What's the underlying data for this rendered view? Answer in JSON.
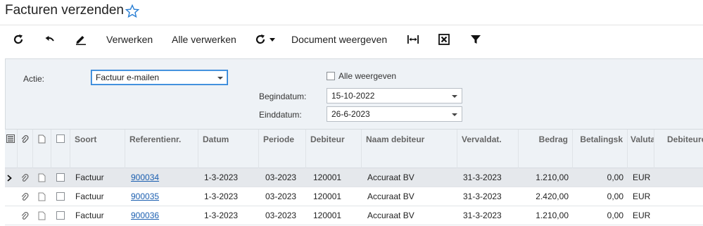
{
  "header": {
    "title": "Facturen verzenden"
  },
  "toolbar": {
    "process_label": "Verwerken",
    "process_all_label": "Alle verwerken",
    "view_document_label": "Document weergeven"
  },
  "filters": {
    "action_label": "Actie:",
    "action_value": "Factuur e-mailen",
    "show_all_label": "Alle weergeven",
    "start_date_label": "Begindatum:",
    "start_date_value": "15-10-2022",
    "end_date_label": "Einddatum:",
    "end_date_value": "26-6-2023"
  },
  "grid": {
    "columns": {
      "type": "Soort",
      "ref": "Referentienr.",
      "date": "Datum",
      "period": "Periode",
      "debtor": "Debiteur",
      "debtor_name": "Naam debiteur",
      "due": "Vervaldat.",
      "amount": "Bedrag",
      "payment": "Betalingsk",
      "currency": "Valuta",
      "debtor_extra": "Debiteurc"
    },
    "rows": [
      {
        "type": "Factuur",
        "ref": "900034",
        "date": "1-3-2023",
        "period": "03-2023",
        "debtor": "120001",
        "debtor_name": "Accuraat BV",
        "due": "31-3-2023",
        "amount": "1.210,00",
        "payment": "0,00",
        "currency": "EUR"
      },
      {
        "type": "Factuur",
        "ref": "900035",
        "date": "1-3-2023",
        "period": "03-2023",
        "debtor": "120001",
        "debtor_name": "Accuraat BV",
        "due": "31-3-2023",
        "amount": "2.420,00",
        "payment": "0,00",
        "currency": "EUR"
      },
      {
        "type": "Factuur",
        "ref": "900036",
        "date": "1-3-2023",
        "period": "03-2023",
        "debtor": "120001",
        "debtor_name": "Accuraat BV",
        "due": "31-3-2023",
        "amount": "1.210,00",
        "payment": "0,00",
        "currency": "EUR"
      }
    ]
  },
  "colors": {
    "accent": "#2a7fd4",
    "link": "#1b5fb0",
    "panel": "#eef2f6"
  }
}
